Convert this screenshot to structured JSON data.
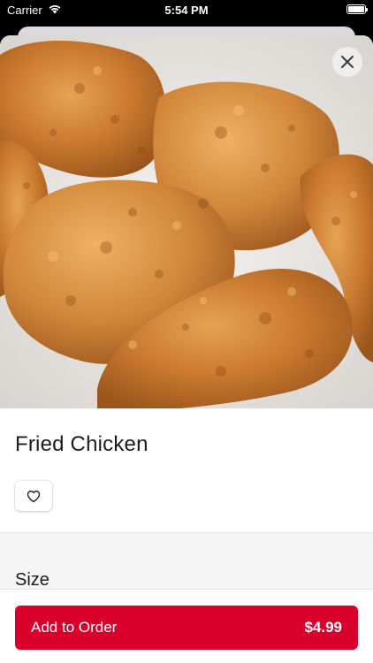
{
  "status_bar": {
    "carrier": "Carrier",
    "time": "5:54 PM",
    "wifi_icon": "wifi-icon",
    "battery_icon": "battery-icon"
  },
  "product": {
    "name": "Fried Chicken",
    "image_alt": "Fried chicken pieces on a plate",
    "favorite_icon": "heart-outline-icon"
  },
  "sections": {
    "size_title": "Size"
  },
  "actions": {
    "close_icon": "close-icon",
    "add_to_order_label": "Add to Order",
    "price": "$4.99"
  },
  "colors": {
    "accent": "#d9002b",
    "background": "#ffffff",
    "section_bg": "#f5f5f6"
  }
}
